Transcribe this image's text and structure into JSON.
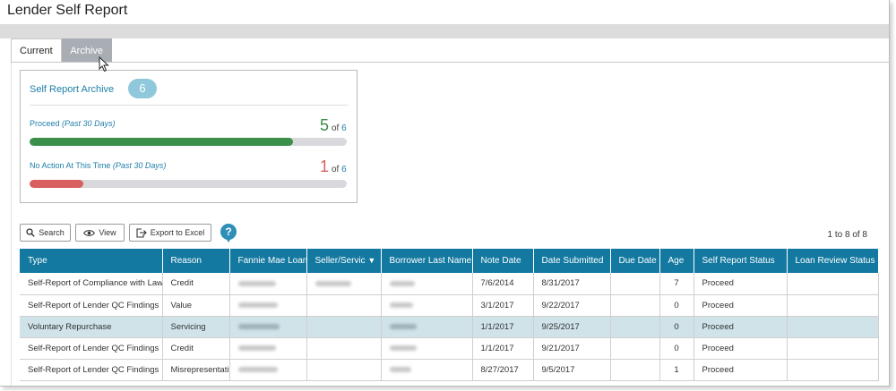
{
  "page": {
    "title": "Lender Self Report"
  },
  "tabs": [
    {
      "label": "Current",
      "active": false
    },
    {
      "label": "Archive",
      "active": true
    }
  ],
  "summary": {
    "title": "Self Report Archive",
    "count": "6",
    "metrics": [
      {
        "label": "Proceed",
        "period": "(Past 30 Days)",
        "value": "5",
        "of": "of",
        "total": "6",
        "color": "#3a8f4b",
        "fraction": 0.83
      },
      {
        "label": "No Action At This Time",
        "period": "(Past 30 Days)",
        "value": "1",
        "of": "of",
        "total": "6",
        "color": "#d9605f",
        "fraction": 0.17
      }
    ]
  },
  "toolbar": {
    "search_label": "Search",
    "view_label": "View",
    "export_label": "Export to Excel",
    "help_label": "?",
    "pager": "1 to 8 of 8"
  },
  "table": {
    "columns": [
      "Type",
      "Reason",
      "Fannie Mae Loan",
      "Seller/Servic",
      "Borrower Last Name",
      "Note Date",
      "Date Submitted",
      "Due Date",
      "Age",
      "Self Report Status",
      "Loan Review Status"
    ],
    "sorted_column_indicator": "▼",
    "rows": [
      {
        "type": "Self-Report of Compliance with Laws",
        "reason": "Credit",
        "note_date": "7/6/2014",
        "date_submitted": "8/31/2017",
        "due_date": "",
        "age": "7",
        "status": "Proceed",
        "review": "",
        "highlight": false
      },
      {
        "type": "Self-Report of Lender QC Findings",
        "reason": "Value",
        "note_date": "3/1/2017",
        "date_submitted": "9/22/2017",
        "due_date": "",
        "age": "0",
        "status": "Proceed",
        "review": "",
        "highlight": false
      },
      {
        "type": "Voluntary Repurchase",
        "reason": "Servicing",
        "note_date": "1/1/2017",
        "date_submitted": "9/25/2017",
        "due_date": "",
        "age": "0",
        "status": "Proceed",
        "review": "",
        "highlight": true
      },
      {
        "type": "Self-Report of Lender QC Findings",
        "reason": "Credit",
        "note_date": "1/1/2017",
        "date_submitted": "9/21/2017",
        "due_date": "",
        "age": "0",
        "status": "Proceed",
        "review": "",
        "highlight": false
      },
      {
        "type": "Self-Report of Lender QC Findings",
        "reason": "Misrepresentati",
        "note_date": "8/27/2017",
        "date_submitted": "9/5/2017",
        "due_date": "",
        "age": "1",
        "status": "Proceed",
        "review": "",
        "highlight": false
      }
    ]
  }
}
